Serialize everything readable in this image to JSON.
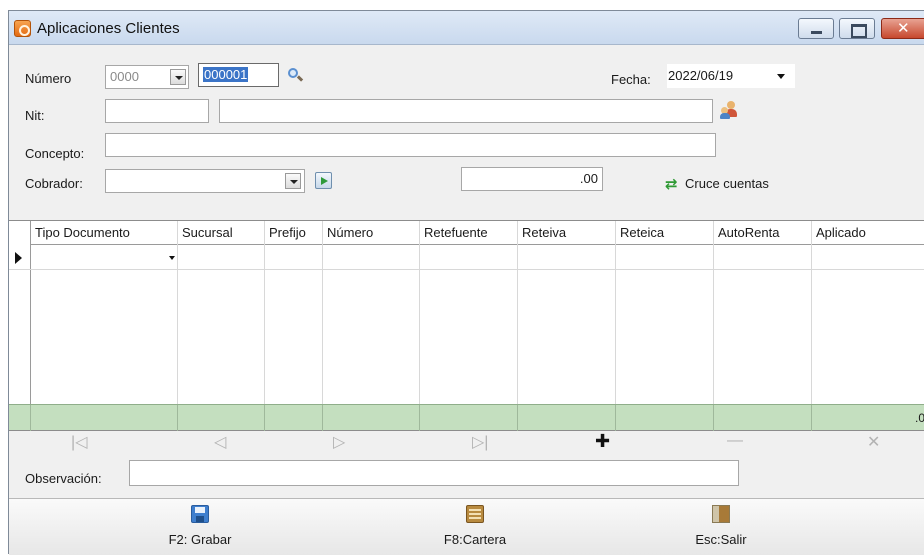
{
  "window": {
    "title": "Aplicaciones  Clientes"
  },
  "form": {
    "numero_label": "Número",
    "numero_prefix": "0000",
    "numero_value": "000001",
    "fecha_label": "Fecha:",
    "fecha_value": "2022/06/19",
    "nit_label": "Nit:",
    "nit_value": "",
    "nit_name": "",
    "concepto_label": "Concepto:",
    "concepto_value": "",
    "cobrador_label": "Cobrador:",
    "cobrador_value": "",
    "amount_value": ".00",
    "cruce_label": "Cruce cuentas"
  },
  "grid": {
    "columns": [
      "Tipo Documento",
      "Sucursal",
      "Prefijo",
      "Número",
      "Retefuente",
      "Reteiva",
      "Reteica",
      "AutoRenta",
      "Aplicado"
    ],
    "total_value": ".0"
  },
  "nav": {
    "first": "|◁",
    "prev": "◁",
    "next": "▷",
    "last": "▷|",
    "add": "✚",
    "remove": "—",
    "cancel": "✕"
  },
  "observacion": {
    "label": "Observación:",
    "value": ""
  },
  "toolbar": {
    "save_label": "F2: Grabar",
    "cartera_label": "F8:Cartera",
    "exit_label": "Esc:Salir"
  },
  "colors": {
    "title_bar": "#c9d9ee",
    "totals_row": "#c4dfbf",
    "selection": "#3b74c7"
  }
}
